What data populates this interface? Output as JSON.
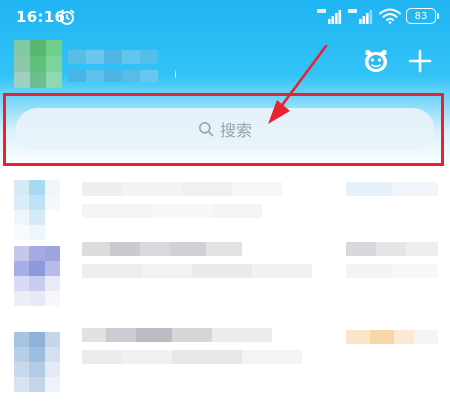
{
  "status_bar": {
    "time": "16:16",
    "battery": "83"
  },
  "search": {
    "placeholder": "搜索"
  },
  "profile": {
    "name_suffix": "i"
  },
  "colors": {
    "header_top": "#1fb4f2",
    "annotation_red": "#e8232f",
    "search_bg": "#e8f2fa"
  },
  "icons": [
    "alarm-icon",
    "signal-icon",
    "wifi-icon",
    "battery-icon",
    "mascot-icon",
    "plus-icon",
    "search-icon"
  ]
}
